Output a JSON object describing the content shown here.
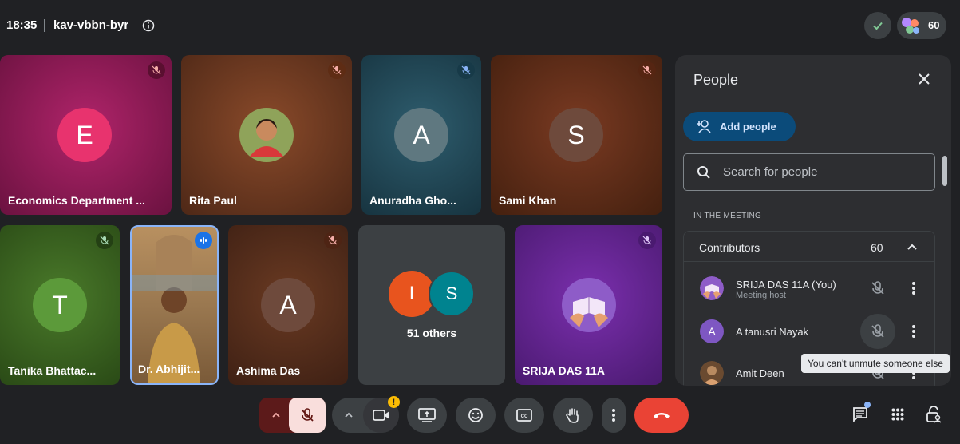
{
  "header": {
    "time": "18:35",
    "meeting_code": "kav-vbbn-byr",
    "participant_count": "60"
  },
  "tiles": [
    {
      "name": "Economics Department ...",
      "initial": "E"
    },
    {
      "name": "Rita Paul"
    },
    {
      "name": "Anuradha Gho...",
      "initial": "A"
    },
    {
      "name": "Sami Khan",
      "initial": "S"
    },
    {
      "name": "Tanika Bhattac...",
      "initial": "T"
    },
    {
      "name": "Dr. Abhijit..."
    },
    {
      "name": "Ashima Das",
      "initial": "A"
    },
    {
      "name": "51 others",
      "initials": [
        "I",
        "S"
      ]
    },
    {
      "name": "SRIJA DAS 11A"
    }
  ],
  "people_panel": {
    "title": "People",
    "add_label": "Add people",
    "search_placeholder": "Search for people",
    "section_label": "IN THE MEETING",
    "group_label": "Contributors",
    "group_count": "60",
    "members": [
      {
        "name": "SRIJA DAS 11A (You)",
        "subtitle": "Meeting host"
      },
      {
        "name": "A tanusri Nayak",
        "initial": "A"
      },
      {
        "name": "Amit Deen"
      }
    ],
    "tooltip": "You can't unmute someone else"
  },
  "colors": {
    "end_call": "#ea4335",
    "muted_bg": "#f9dedc",
    "accent_blue": "#8ab4f8"
  }
}
